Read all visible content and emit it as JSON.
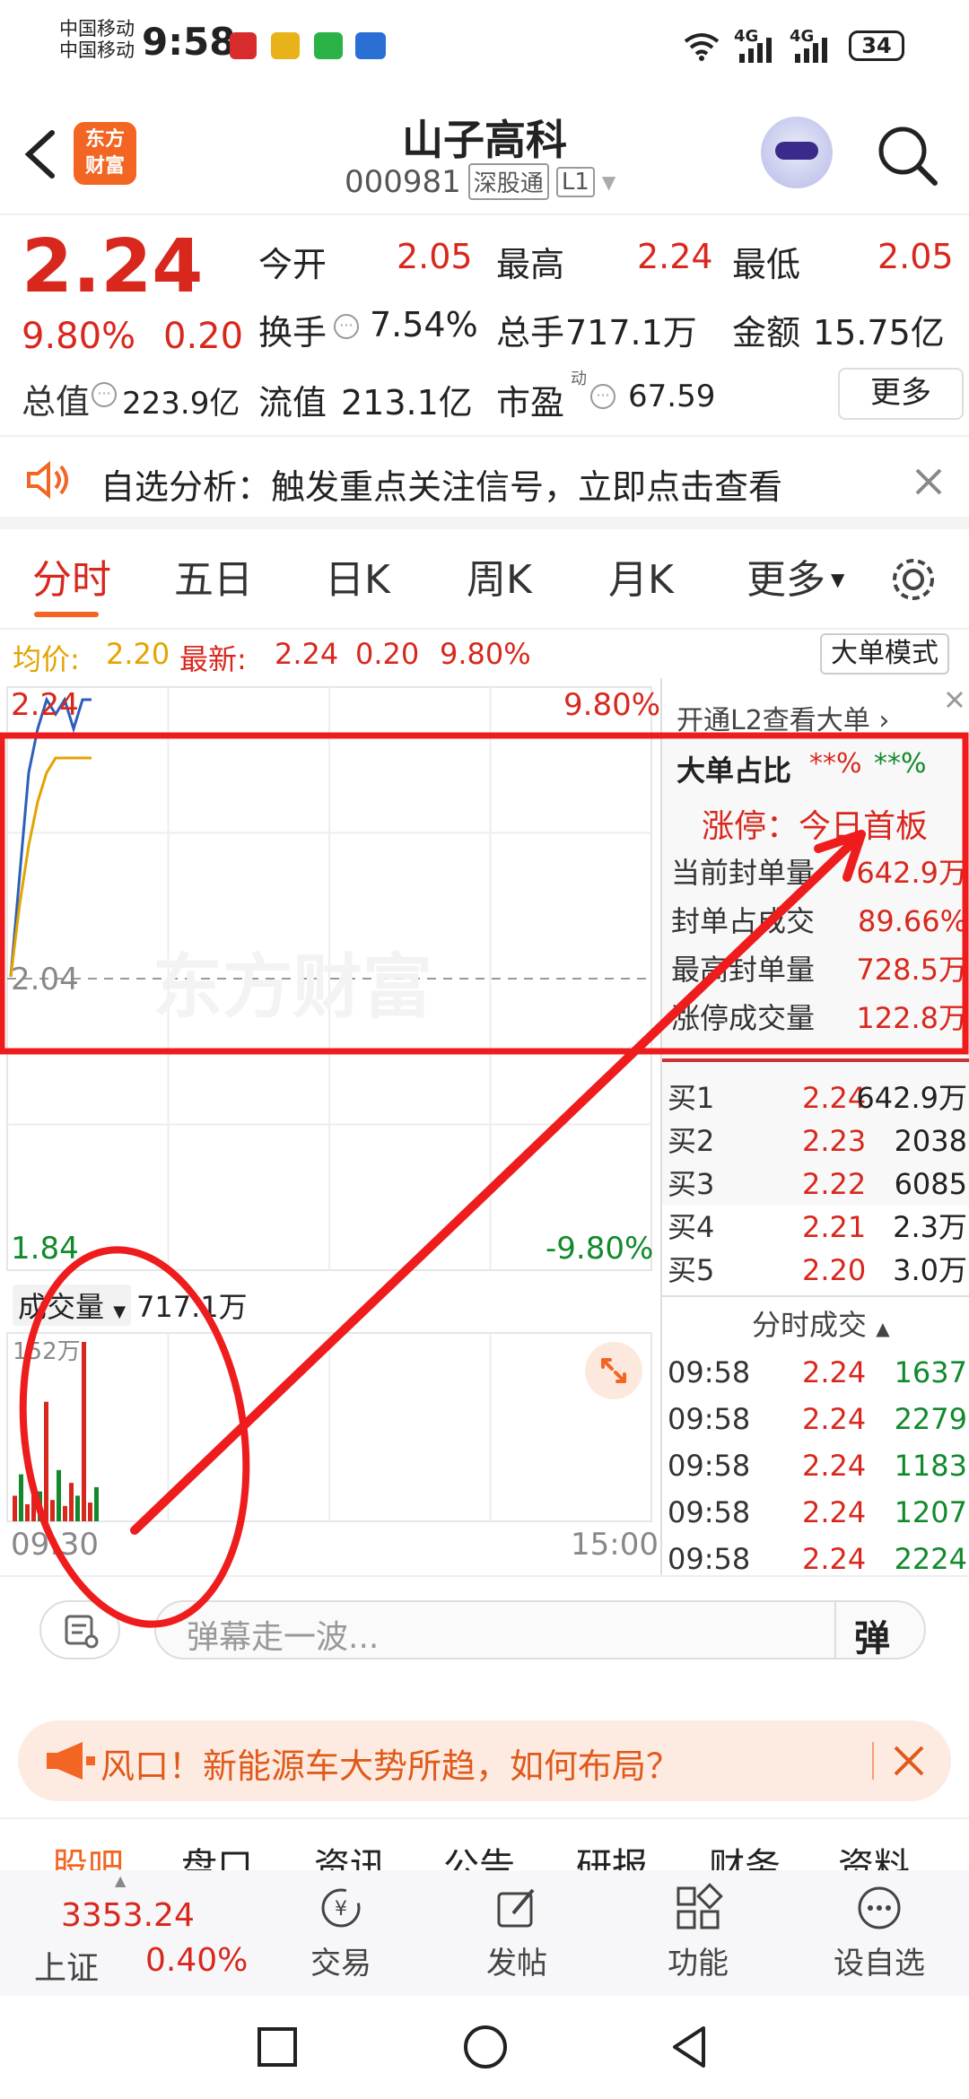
{
  "status_bar": {
    "carrier1": "中国移动",
    "carrier2": "中国移动",
    "time": "9:58",
    "signal1": "4G",
    "signal2": "4G",
    "battery": "34"
  },
  "header": {
    "stock_name": "山子高科",
    "stock_code": "000981",
    "badge1": "深股通",
    "badge2": "L1",
    "logo_line1": "东方",
    "logo_line2": "财富"
  },
  "quote": {
    "price": "2.24",
    "change_pct": "9.80%",
    "change_amt": "0.20",
    "open_label": "今开",
    "open": "2.05",
    "high_label": "最高",
    "high": "2.24",
    "low_label": "最低",
    "low": "2.05",
    "turnover_label": "换手",
    "turnover": "7.54%",
    "volume_label": "总手",
    "volume": "717.1万",
    "amount_label": "金额",
    "amount": "15.75亿",
    "mktcap_label": "总值",
    "mktcap": "223.9亿",
    "float_label": "流值",
    "float": "213.1亿",
    "pe_label": "市盈",
    "pe_sup": "动",
    "pe": "67.59",
    "more": "更多"
  },
  "alert": {
    "text": "自选分析：触发重点关注信号，立即点击查看"
  },
  "tabs": [
    "分时",
    "五日",
    "日K",
    "周K",
    "月K",
    "更多"
  ],
  "chart_info": {
    "avg_label": "均价:",
    "avg": "2.20",
    "latest_label": "最新:",
    "latest": "2.24",
    "chg": "0.20",
    "pct": "9.80%",
    "mode": "大单模式"
  },
  "chart_data": {
    "type": "line",
    "title": "",
    "price_top": "2.24",
    "pct_top": "9.80%",
    "price_mid": "2.04",
    "price_bottom": "1.84",
    "pct_bottom": "-9.80%",
    "watermark": "东方财富",
    "time_start": "09:30",
    "time_end": "15:00",
    "series": [
      {
        "values": [
          2.05,
          2.12,
          2.19,
          2.22,
          2.24,
          2.23,
          2.24,
          2.22,
          2.24,
          2.24
        ]
      },
      {
        "values": [
          2.05,
          2.1,
          2.14,
          2.17,
          2.19,
          2.2,
          2.2,
          2.2,
          2.2,
          2.2
        ]
      }
    ],
    "volume": {
      "label": "成交量",
      "total": "717.1万",
      "max": "152万"
    }
  },
  "panel": {
    "promo": "开通L2查看大单",
    "big_label": "大单占比",
    "big_buy": "**%",
    "big_sell": "**%",
    "limit_text": "涨停：今日首板",
    "stats": [
      {
        "k": "当前封单量",
        "v": "642.9万"
      },
      {
        "k": "封单占成交",
        "v": "89.66%"
      },
      {
        "k": "最高封单量",
        "v": "728.5万"
      },
      {
        "k": "涨停成交量",
        "v": "122.8万"
      }
    ],
    "bids": [
      {
        "k": "买1",
        "p": "2.24",
        "v": "642.9万"
      },
      {
        "k": "买2",
        "p": "2.23",
        "v": "2038"
      },
      {
        "k": "买3",
        "p": "2.22",
        "v": "6085"
      },
      {
        "k": "买4",
        "p": "2.21",
        "v": "2.3万"
      },
      {
        "k": "买5",
        "p": "2.20",
        "v": "3.0万"
      }
    ],
    "ticks_title": "分时成交",
    "ticks": [
      {
        "t": "09:58",
        "p": "2.24",
        "v": "1637"
      },
      {
        "t": "09:58",
        "p": "2.24",
        "v": "2279"
      },
      {
        "t": "09:58",
        "p": "2.24",
        "v": "1183"
      },
      {
        "t": "09:58",
        "p": "2.24",
        "v": "1207"
      },
      {
        "t": "09:58",
        "p": "2.24",
        "v": "2224"
      }
    ]
  },
  "danmu": {
    "placeholder": "弹幕走一波...",
    "btn": "弹"
  },
  "banner": {
    "text": "风口！新能源车大势所趋，如何布局？"
  },
  "subtabs": [
    "股吧",
    "盘口",
    "资讯",
    "公告",
    "研报",
    "财务",
    "资料"
  ],
  "bottom_nav": {
    "index_value": "3353.24",
    "index_name": "上证",
    "index_pct": "0.40%",
    "items": [
      "交易",
      "发帖",
      "功能",
      "设自选"
    ]
  },
  "colors": {
    "up": "#d8281e",
    "down": "#118a2c",
    "annotation": "#ee1c1c",
    "brand": "#f26522"
  }
}
